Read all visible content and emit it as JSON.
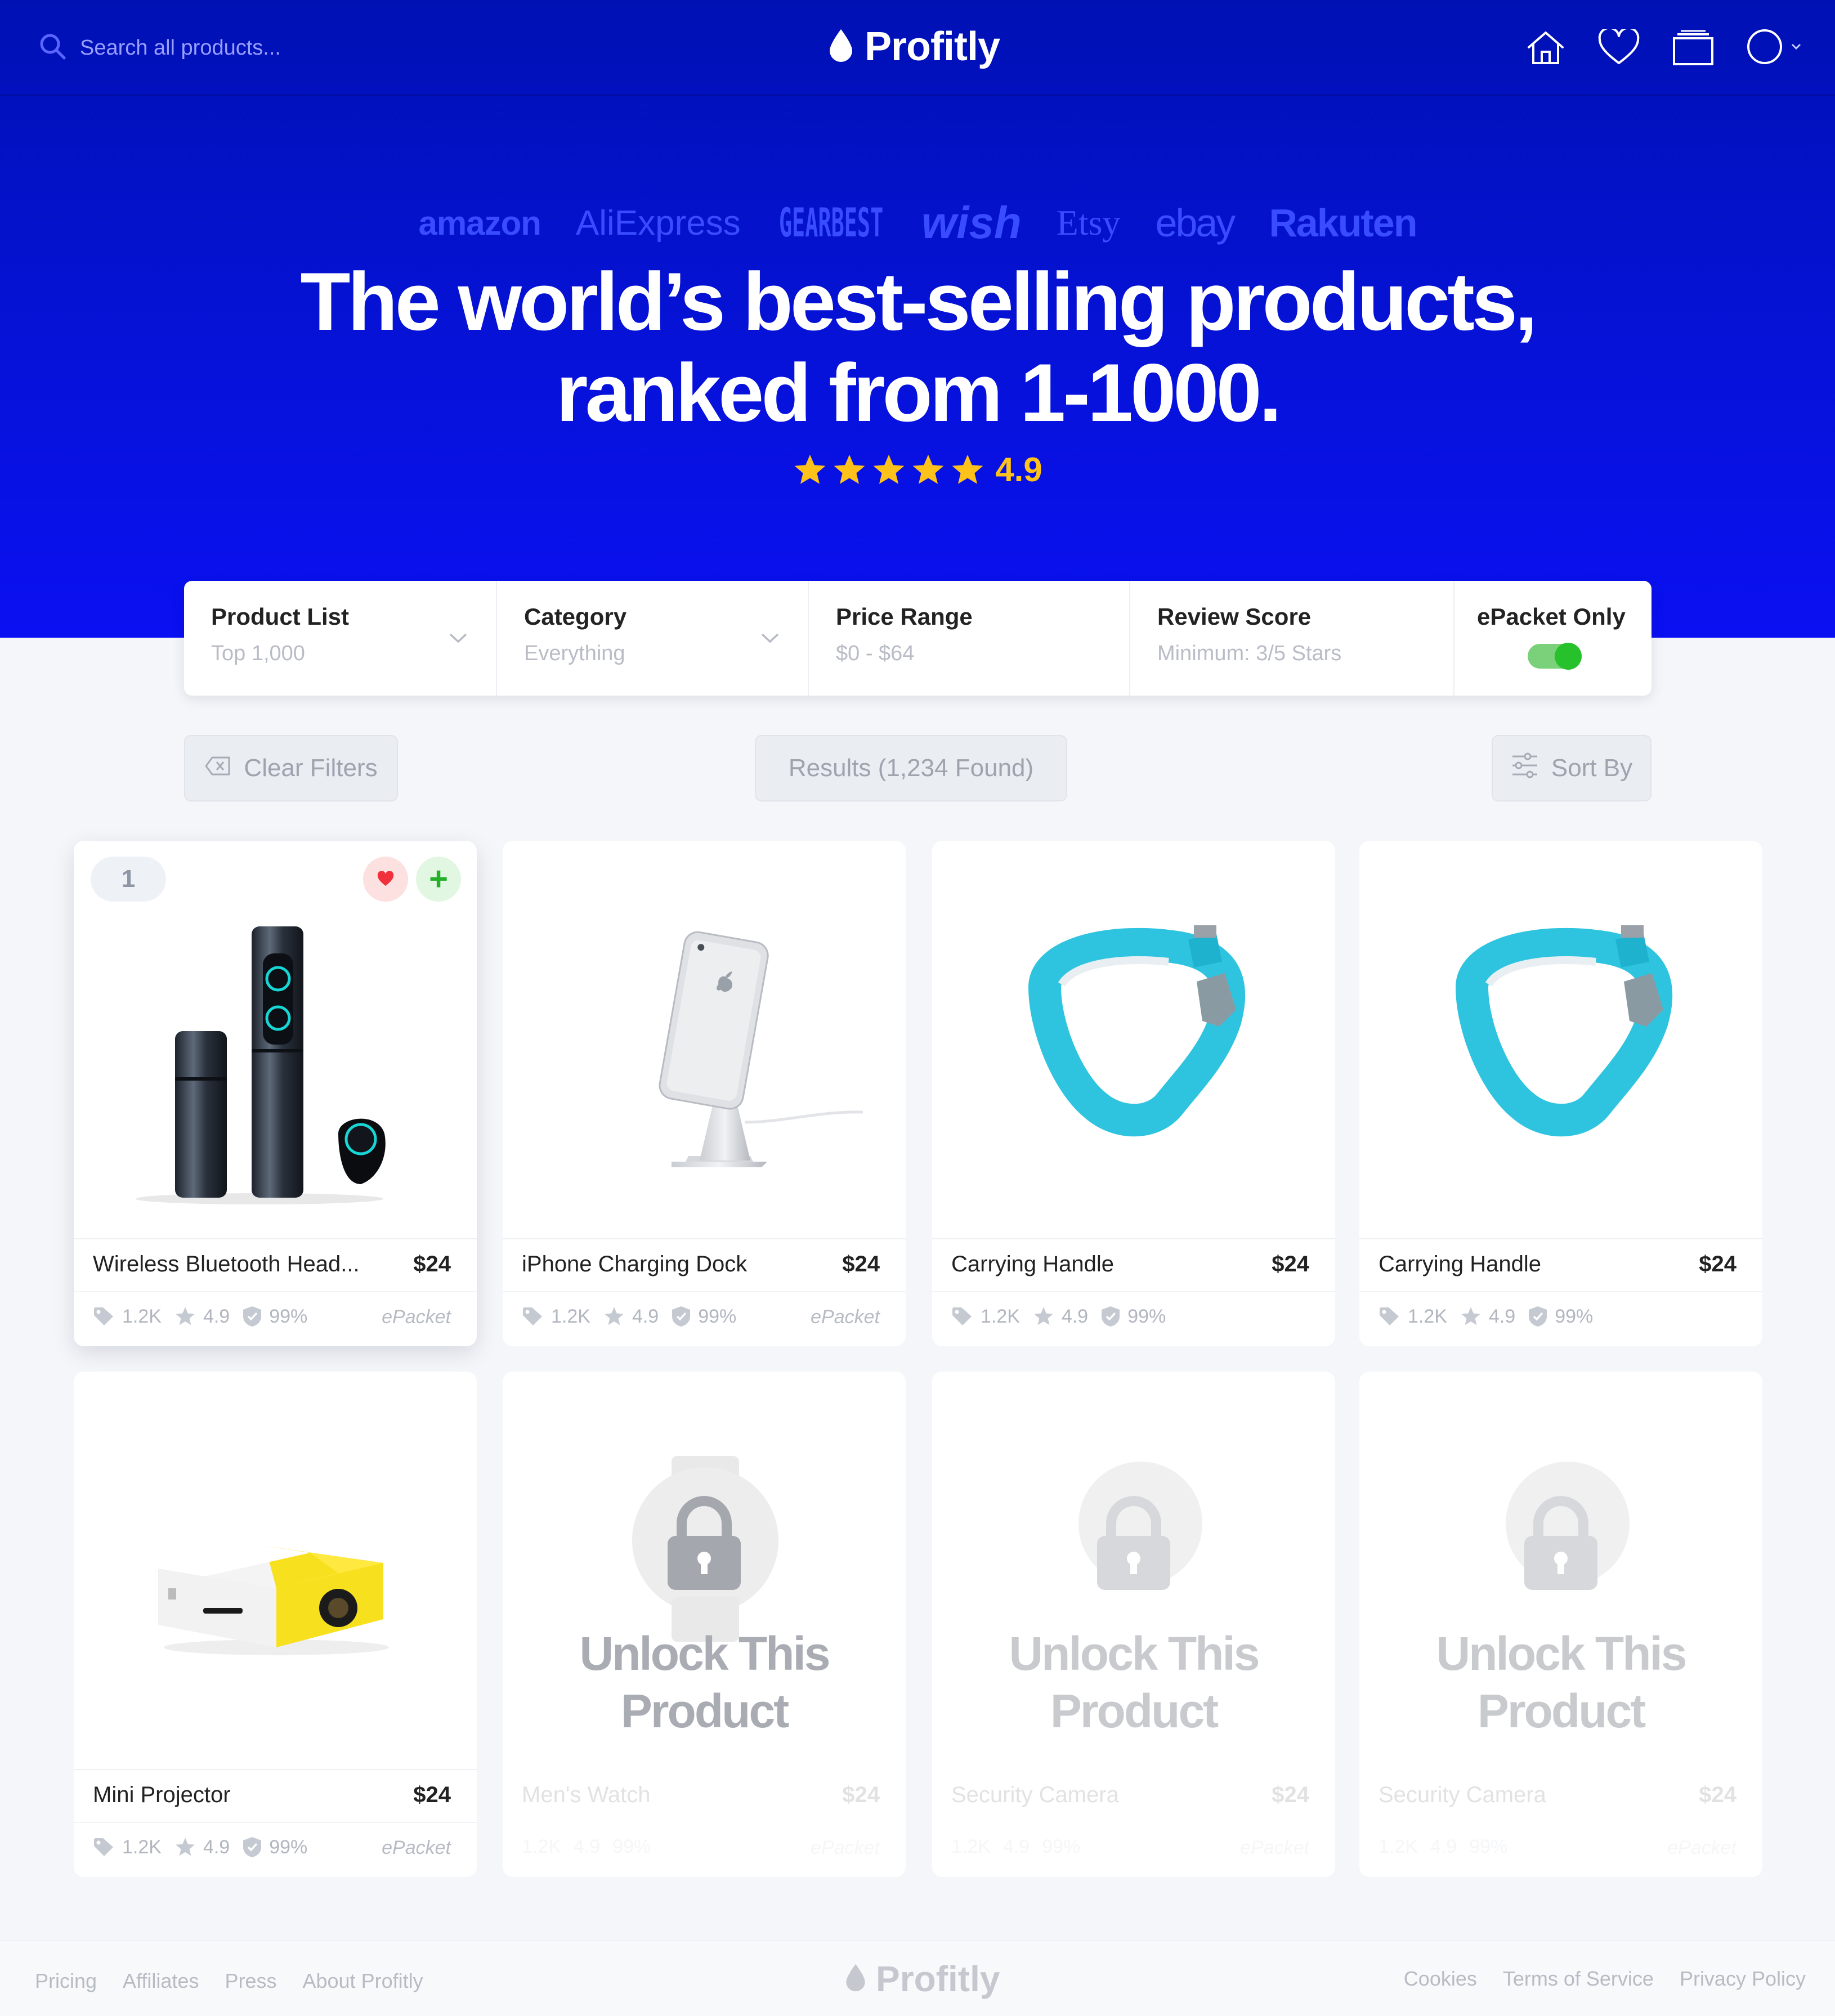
{
  "header": {
    "search_placeholder": "Search all products...",
    "logo_text": "Profitly"
  },
  "hero": {
    "marketplaces": [
      "amazon",
      "AliExpress",
      "GEARBEST",
      "wish",
      "Etsy",
      "ebay",
      "Rakuten"
    ],
    "headline_line1": "The world’s best-selling products,",
    "headline_line2": "ranked from 1-1000.",
    "rating_value": "4.9",
    "rating_stars": 5
  },
  "filters": {
    "product_list": {
      "label": "Product List",
      "value": "Top 1,000"
    },
    "category": {
      "label": "Category",
      "value": "Everything"
    },
    "price_range": {
      "label": "Price Range",
      "value": "$0 - $64"
    },
    "review_score": {
      "label": "Review Score",
      "value": "Minimum: 3/5 Stars"
    },
    "epacket": {
      "label": "ePacket Only",
      "enabled": true
    }
  },
  "actions": {
    "clear_filters": "Clear Filters",
    "results": "Results (1,234 Found)",
    "sort_by": "Sort By"
  },
  "products": [
    {
      "rank": "1",
      "name": "Wireless Bluetooth Head...",
      "price": "$24",
      "orders": "1.2K",
      "rating": "4.9",
      "feedback": "99%",
      "shipping": "ePacket",
      "image": "earbuds-image"
    },
    {
      "name": "iPhone Charging Dock",
      "price": "$24",
      "orders": "1.2K",
      "rating": "4.9",
      "feedback": "99%",
      "shipping": "ePacket",
      "image": "phone-stand-image"
    },
    {
      "name": "Carrying Handle",
      "price": "$24",
      "orders": "1.2K",
      "rating": "4.9",
      "feedback": "99%",
      "image": "handle-image"
    },
    {
      "name": "Carrying Handle",
      "price": "$24",
      "orders": "1.2K",
      "rating": "4.9",
      "feedback": "99%",
      "image": "handle-image"
    },
    {
      "name": "Mini Projector",
      "price": "$24",
      "orders": "1.2K",
      "rating": "4.9",
      "feedback": "99%",
      "shipping": "ePacket",
      "image": "projector-image"
    }
  ],
  "locked_products": [
    {
      "unlock_line1": "Unlock This",
      "unlock_line2": "Product",
      "name": "Men's Watch",
      "price": "$24",
      "orders": "1.2K",
      "rating": "4.9",
      "feedback": "99%",
      "shipping": "ePacket"
    },
    {
      "unlock_line1": "Unlock This",
      "unlock_line2": "Product",
      "name": "Security Camera",
      "price": "$24",
      "orders": "1.2K",
      "rating": "4.9",
      "feedback": "99%",
      "shipping": "ePacket"
    },
    {
      "unlock_line1": "Unlock This",
      "unlock_line2": "Product",
      "name": "Security Camera",
      "price": "$24",
      "orders": "1.2K",
      "rating": "4.9",
      "feedback": "99%",
      "shipping": "ePacket"
    }
  ],
  "footer": {
    "left_links": [
      "Pricing",
      "Affiliates",
      "Press",
      "About Profitly"
    ],
    "logo_text": "Profitly",
    "right_links": [
      "Cookies",
      "Terms of Service",
      "Privacy Policy"
    ]
  },
  "colors": {
    "hero_blue": "#0612d8",
    "marketplace_blue": "#3a4cff",
    "star_yellow": "#ffc21a",
    "toggle_green": "#26c12b",
    "favorite_red": "#f0303a"
  }
}
